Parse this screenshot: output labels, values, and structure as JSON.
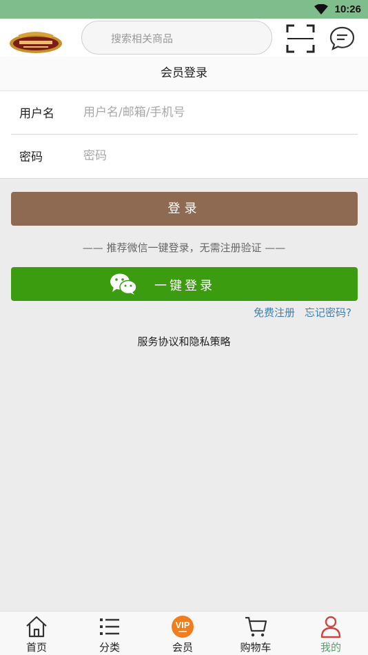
{
  "status_bar": {
    "time": "10:26",
    "wifi_icon": "wifi-icon"
  },
  "header": {
    "logo_icon": "brand-logo",
    "search_placeholder": "搜索相关商品",
    "scan_icon": "scan-icon",
    "message_icon": "message-icon"
  },
  "page": {
    "title": "会员登录"
  },
  "form": {
    "username_label": "用户名",
    "username_placeholder": "用户名/邮箱/手机号",
    "username_value": "",
    "password_label": "密码",
    "password_placeholder": "密码",
    "password_value": ""
  },
  "actions": {
    "login_label": "登录",
    "recommend_tip": "—— 推荐微信一键登录，无需注册验证 ——",
    "wechat_label": "一键登录",
    "wechat_icon": "wechat-icon",
    "register_link": "免费注册",
    "forgot_link": "忘记密码?",
    "policy_text": "服务协议和隐私策略"
  },
  "tabbar": {
    "items": [
      {
        "label": "首页",
        "icon": "home-icon"
      },
      {
        "label": "分类",
        "icon": "list-icon"
      },
      {
        "label": "会员",
        "icon": "vip-icon"
      },
      {
        "label": "购物车",
        "icon": "cart-icon"
      },
      {
        "label": "我的",
        "icon": "user-icon",
        "active": true
      }
    ]
  },
  "colors": {
    "status_bar": "#7fbe8c",
    "login_button": "#8f6a52",
    "wechat_button": "#3b9c10",
    "link": "#3f7fb0",
    "tab_active": "#4da56a",
    "user_icon_active": "#d2423d",
    "vip_badge": "#f07d1e"
  }
}
